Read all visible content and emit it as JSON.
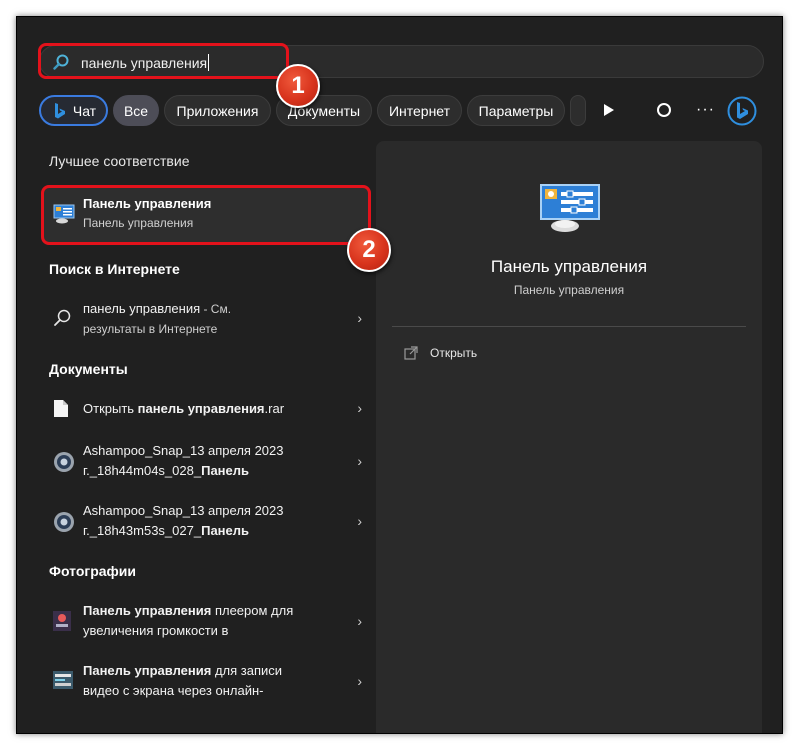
{
  "search": {
    "query": "панель управления"
  },
  "filters": {
    "chat": "Чат",
    "all": "Все",
    "apps": "Приложения",
    "documents": "Документы",
    "internet": "Интернет",
    "settings": "Параметры",
    "more_dots": "···"
  },
  "sections": {
    "best_match": "Лучшее соответствие",
    "web_search": "Поиск в Интернете",
    "documents": "Документы",
    "photos": "Фотографии"
  },
  "best_match": {
    "title": "Панель управления",
    "subtitle": "Панель управления"
  },
  "web": {
    "query": "панель управления",
    "suffix_1": " - См.",
    "suffix_2": "результаты в Интернете"
  },
  "documents": [
    {
      "prefix": "Открыть ",
      "bold": "панель управления",
      "suffix": ".rar"
    },
    {
      "line1": "Ashampoo_Snap_13 апреля 2023",
      "line2_pre": "г._18h44m04s_028_",
      "line2_bold": "Панель"
    },
    {
      "line1": "Ashampoo_Snap_13 апреля 2023",
      "line2_pre": "г._18h43m53s_027_",
      "line2_bold": "Панель"
    }
  ],
  "photos": [
    {
      "bold": "Панель управления",
      "line1_rest": " плеером для",
      "line2": "увеличения громкости в"
    },
    {
      "bold": "Панель управления",
      "line1_rest": " для записи",
      "line2": "видео с экрана через онлайн-"
    }
  ],
  "preview": {
    "title": "Панель управления",
    "subtitle": "Панель управления",
    "open_label": "Открыть"
  },
  "badges": {
    "one": "1",
    "two": "2"
  },
  "icons": {
    "chevron": "›"
  },
  "colors": {
    "background": "#202020",
    "pane": "#2a2a2a",
    "highlight_red": "#e3121b",
    "accent_blue": "#3a7be0"
  }
}
